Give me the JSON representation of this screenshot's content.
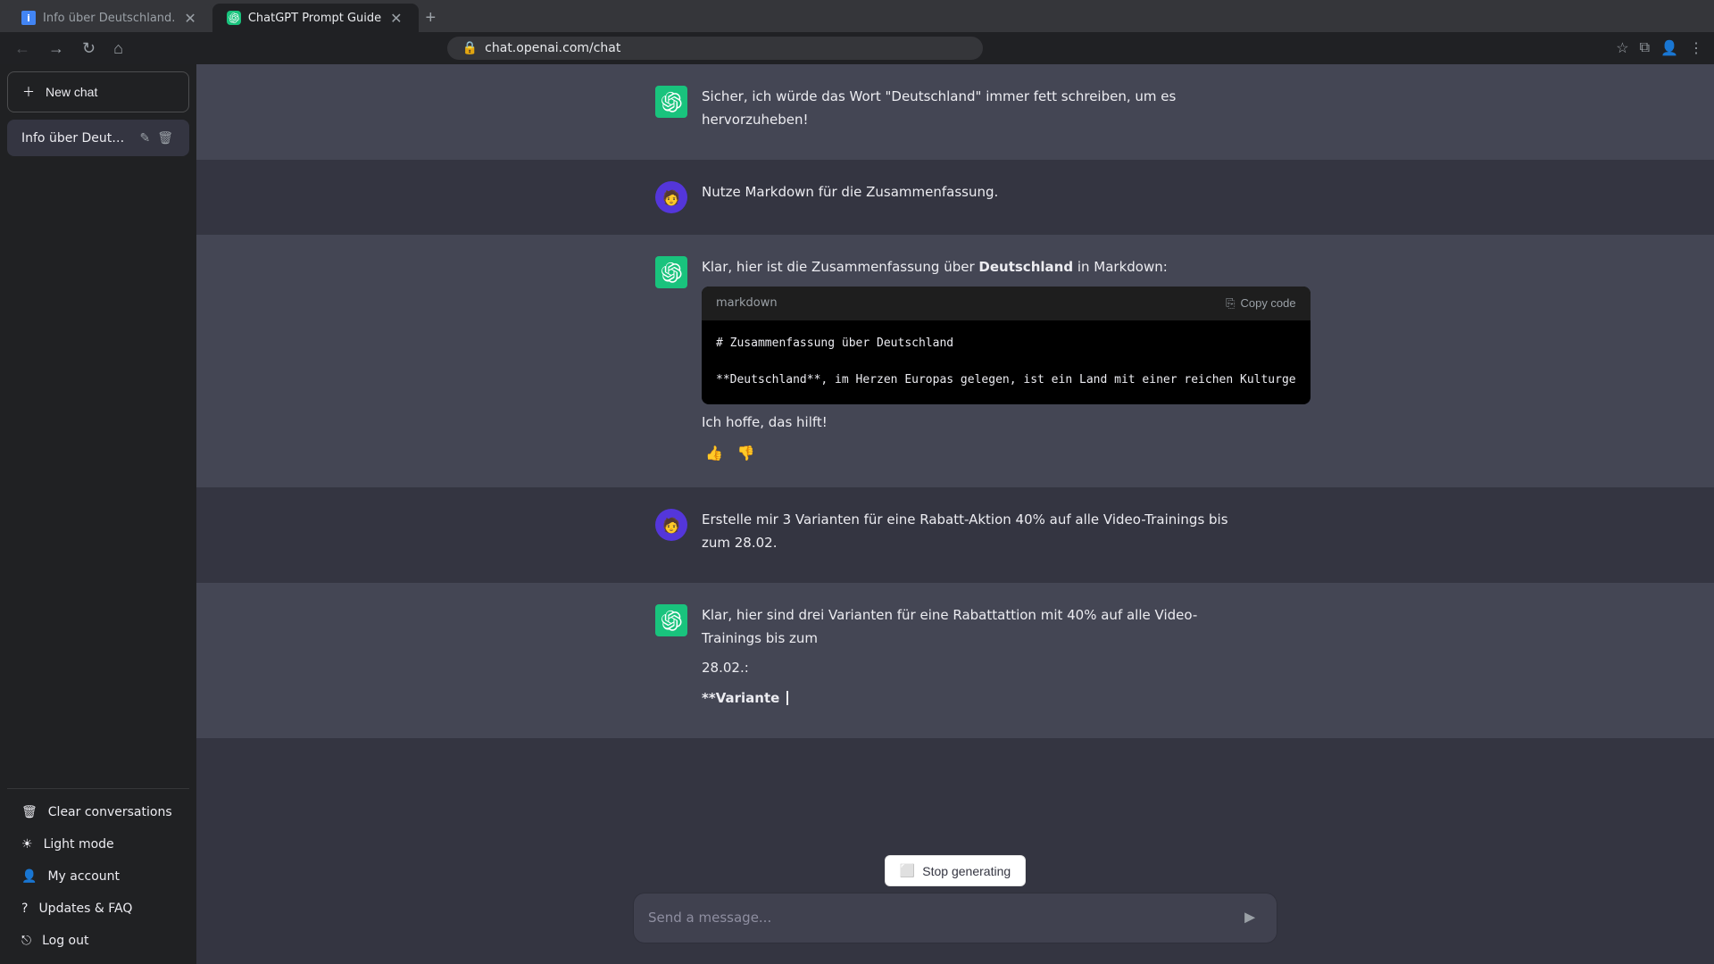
{
  "browser": {
    "tabs": [
      {
        "id": "tab1",
        "title": "Info über Deutschland.",
        "favicon_color": "#4285f4",
        "active": false
      },
      {
        "id": "tab2",
        "title": "ChatGPT Prompt Guide",
        "favicon_color": "#19c37d",
        "active": true
      }
    ],
    "url": "chat.openai.com/chat"
  },
  "sidebar": {
    "new_chat_label": "New chat",
    "chat_items": [
      {
        "title": "Info über Deutschland.",
        "active": true
      }
    ],
    "bottom_items": [
      {
        "id": "clear",
        "label": "Clear conversations",
        "icon": "🗑"
      },
      {
        "id": "light",
        "label": "Light mode",
        "icon": "☀"
      },
      {
        "id": "account",
        "label": "My account",
        "icon": "👤"
      },
      {
        "id": "updates",
        "label": "Updates & FAQ",
        "icon": "?"
      },
      {
        "id": "logout",
        "label": "Log out",
        "icon": "⎋"
      }
    ]
  },
  "messages": [
    {
      "id": "msg1",
      "role": "assistant",
      "text_parts": [
        "Sicher, ich würde das Wort \"Deutschland\" immer fett schreiben, um es hervorzuheben!"
      ],
      "show_actions": false
    },
    {
      "id": "msg2",
      "role": "user",
      "text": "Nutze Markdown für die Zusammenfassung.",
      "show_actions": false
    },
    {
      "id": "msg3",
      "role": "assistant",
      "intro": "Klar, hier ist die Zusammenfassung über ",
      "bold_word": "Deutschland",
      "intro_end": " in Markdown:",
      "code_lang": "markdown",
      "code_line1": "# Zusammenfassung über Deutschland",
      "code_line2": "",
      "code_line3": "**Deutschland**, im Herzen Europas gelegen, ist ein Land mit einer reichen Kulturge",
      "outro": "Ich hoffe, das hilft!",
      "copy_label": "Copy code",
      "show_actions": true
    },
    {
      "id": "msg4",
      "role": "user",
      "text": "Erstelle mir 3 Varianten für eine Rabatt-Aktion 40% auf alle Video-Trainings bis zum 28.02.",
      "show_actions": false
    },
    {
      "id": "msg5",
      "role": "assistant",
      "line1": "Klar, hier sind drei Varianten für eine Rabattattion mit 40% auf alle Video-Trainings bis zum",
      "line2": "28.02.:",
      "line3_before": "",
      "line3_bold": "**Variante ",
      "streaming": true,
      "show_actions": false
    }
  ],
  "stop_generating": {
    "label": "Stop generating"
  },
  "input": {
    "placeholder": "Send a message..."
  }
}
